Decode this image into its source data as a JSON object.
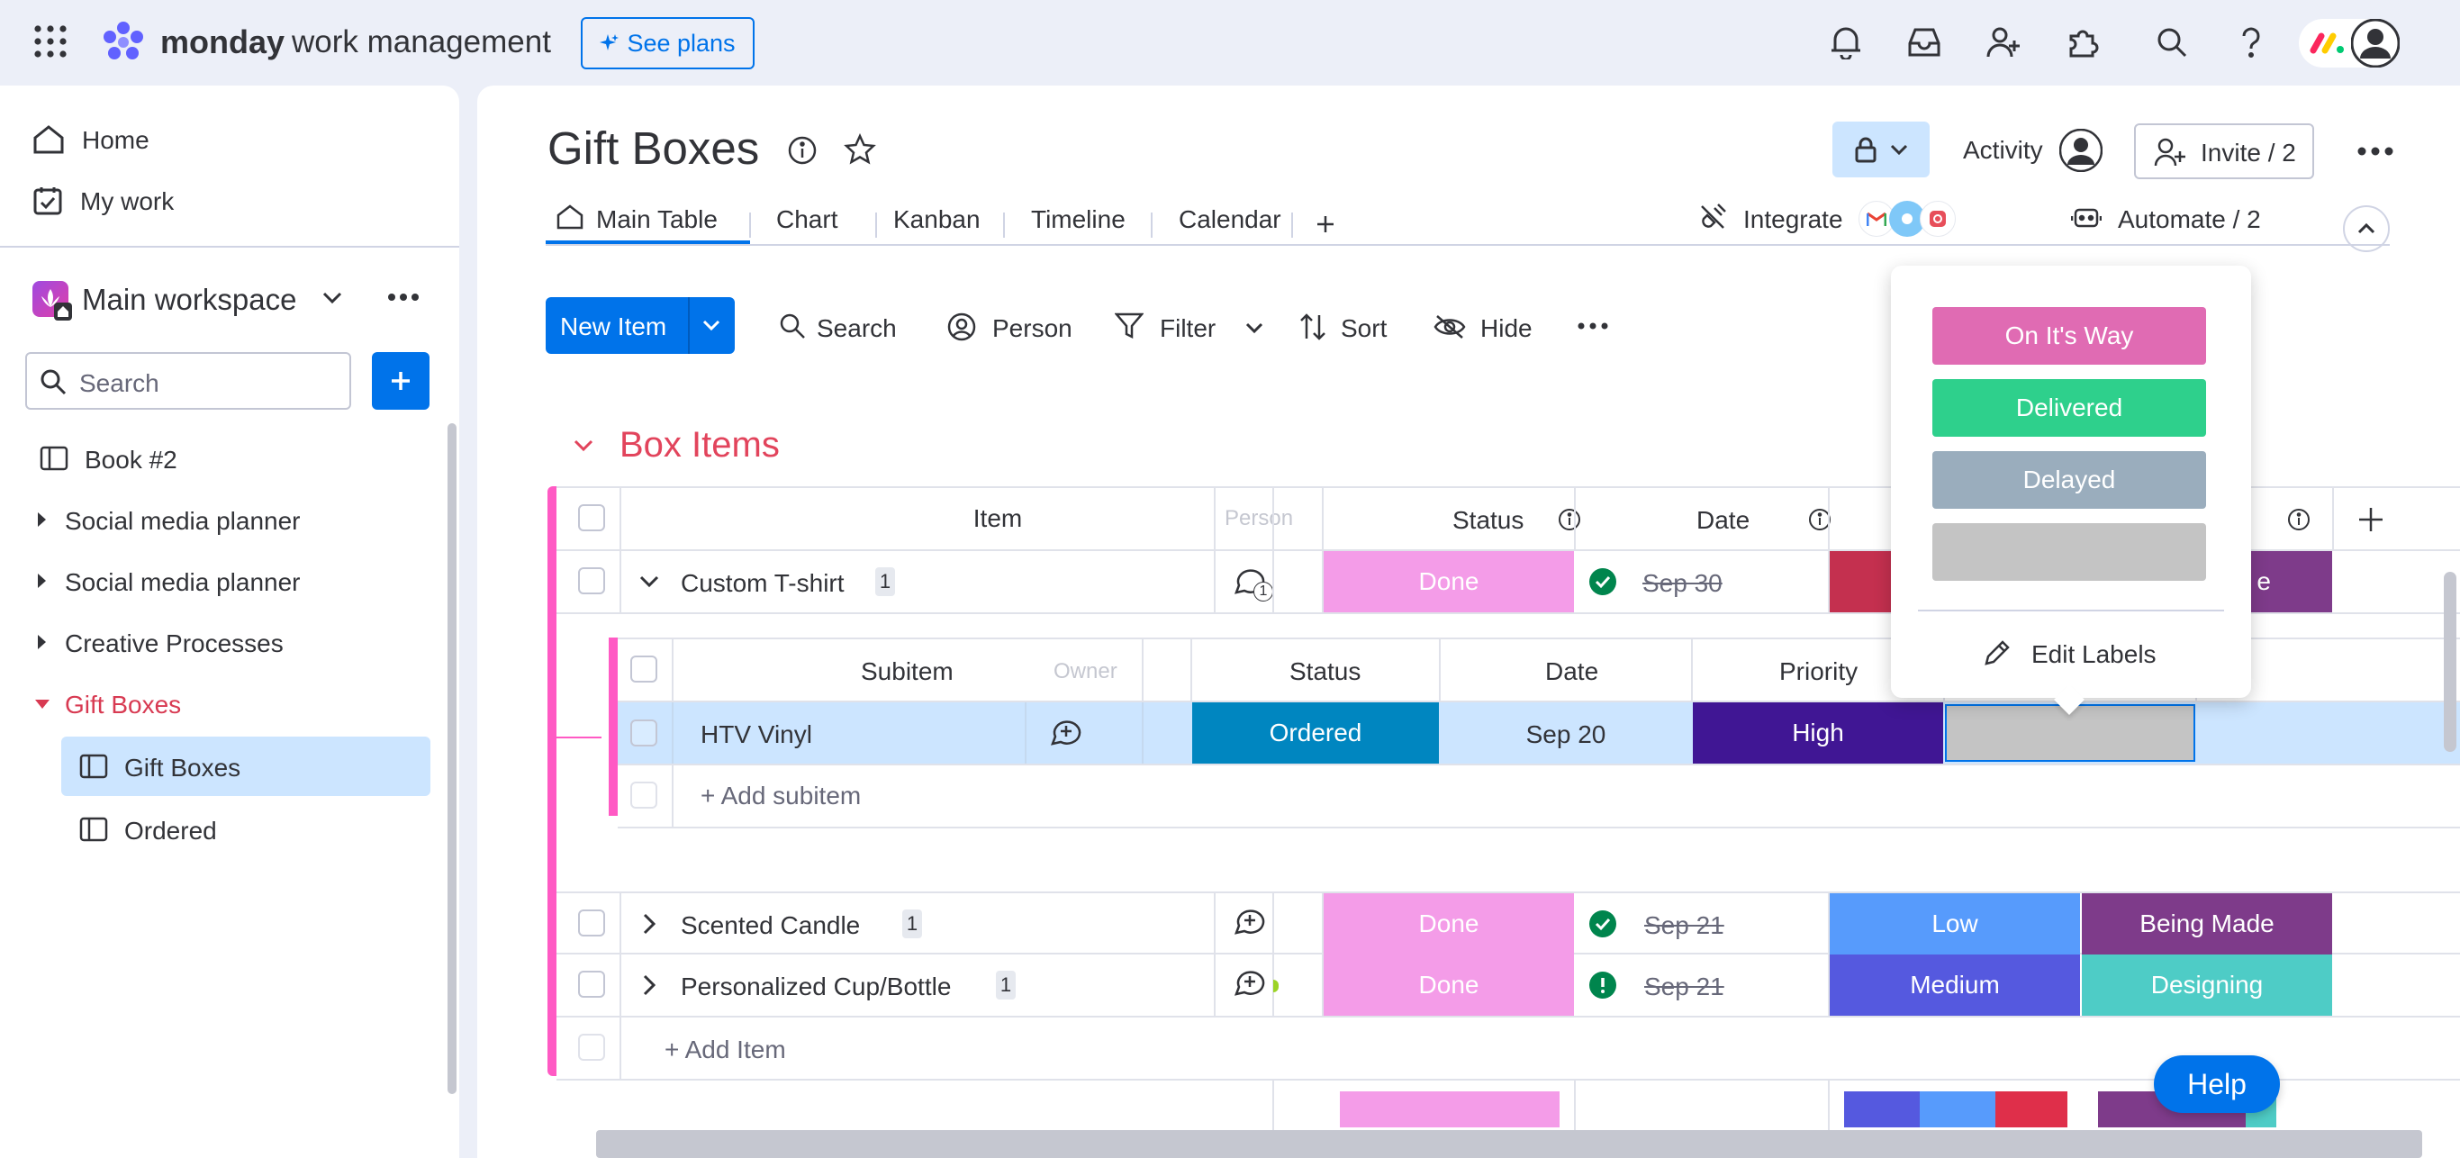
{
  "topbar": {
    "brand_bold": "monday",
    "brand_light": "work management",
    "see_plans": "See plans"
  },
  "sidebar": {
    "home": "Home",
    "my_work": "My work",
    "workspace": "Main workspace",
    "search_placeholder": "Search",
    "items": [
      "Book #2",
      "Social media planner",
      "Social media planner",
      "Creative Processes",
      "Gift Boxes"
    ],
    "sub_items": [
      "Gift Boxes",
      "Ordered"
    ]
  },
  "board": {
    "title": "Gift Boxes",
    "activity": "Activity",
    "invite": "Invite / 2",
    "tabs": [
      "Main Table",
      "Chart",
      "Kanban",
      "Timeline",
      "Calendar"
    ],
    "integrate": "Integrate",
    "automate": "Automate / 2",
    "toolbar": {
      "new_item": "New Item",
      "search": "Search",
      "person": "Person",
      "filter": "Filter",
      "sort": "Sort",
      "hide": "Hide"
    }
  },
  "group": {
    "name": "Box Items",
    "color": "#e2445c",
    "columns": {
      "item": "Item",
      "person": "Person",
      "status": "Status",
      "date": "Date"
    },
    "rows": [
      {
        "name": "Custom T-shirt",
        "count": "1",
        "status": "Done",
        "date": "Sep 30",
        "chat_count": "1"
      },
      {
        "name": "Scented Candle",
        "count": "1",
        "status": "Done",
        "date": "Sep 21",
        "priority": "Low",
        "stage": "Being Made"
      },
      {
        "name": "Personalized Cup/Bottle",
        "count": "1",
        "status": "Done",
        "date": "Sep 21",
        "priority": "Medium",
        "stage": "Designing"
      }
    ],
    "first_row_stage_tail": "e",
    "add_item": "+ Add Item"
  },
  "subitems": {
    "columns": {
      "subitem": "Subitem",
      "owner": "Owner",
      "status": "Status",
      "date": "Date",
      "priority": "Priority"
    },
    "row": {
      "name": "HTV Vinyl",
      "status": "Ordered",
      "date": "Sep 20",
      "priority": "High"
    },
    "add": "+ Add subitem"
  },
  "dropdown": {
    "labels": [
      {
        "text": "On It's Way",
        "color": "#e06bb3"
      },
      {
        "text": "Delivered",
        "color": "#2ed08c"
      },
      {
        "text": "Delayed",
        "color": "#9aadbd"
      },
      {
        "text": "",
        "color": "#c4c4c4"
      }
    ],
    "edit_labels": "Edit Labels"
  },
  "help": "Help",
  "colors": {
    "done": "#f49ce8",
    "ordered": "#0086c0",
    "high": "#401694",
    "low": "#579bfc",
    "medium": "#5559df",
    "being_made": "#7e3b8a",
    "designing": "#4eccc6",
    "stuck": "#df2f4a",
    "primary": "#0073ea"
  }
}
